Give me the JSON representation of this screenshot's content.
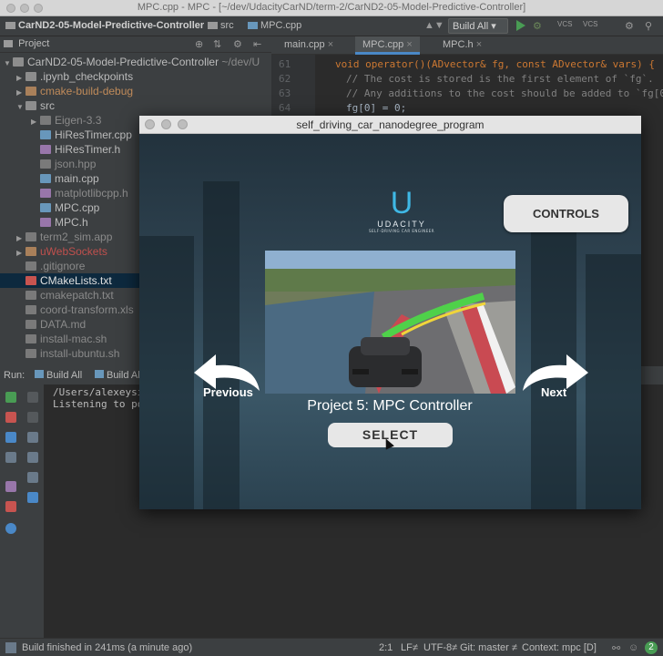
{
  "window": {
    "title": "MPC.cpp - MPC - [~/dev/UdacityCarND/term-2/CarND2-05-Model-Predictive-Controller]"
  },
  "navbar": {
    "project": "CarND2-05-Model-Predictive-Controller",
    "folder": "src",
    "file": "MPC.cpp",
    "build_config": "Build All",
    "vcs1": "VCS",
    "vcs2": "VCS"
  },
  "project_panel": {
    "title": "Project",
    "root": "CarND2-05-Model-Predictive-Controller",
    "root_path": "~/dev/U",
    "items": [
      {
        "label": ".ipynb_checkpoints"
      },
      {
        "label": "cmake-build-debug"
      },
      {
        "label": "src"
      },
      {
        "label": "Eigen-3.3"
      },
      {
        "label": "HiResTimer.cpp"
      },
      {
        "label": "HiResTimer.h"
      },
      {
        "label": "json.hpp"
      },
      {
        "label": "main.cpp"
      },
      {
        "label": "matplotlibcpp.h"
      },
      {
        "label": "MPC.cpp"
      },
      {
        "label": "MPC.h"
      },
      {
        "label": "term2_sim.app"
      },
      {
        "label": "uWebSockets"
      },
      {
        "label": ".gitignore"
      },
      {
        "label": "CMakeLists.txt"
      },
      {
        "label": "cmakepatch.txt"
      },
      {
        "label": "coord-transform.xls"
      },
      {
        "label": "DATA.md"
      },
      {
        "label": "install-mac.sh"
      },
      {
        "label": "install-ubuntu.sh"
      }
    ]
  },
  "editor": {
    "tabs": [
      {
        "label": "main.cpp"
      },
      {
        "label": "MPC.cpp"
      },
      {
        "label": "MPC.h"
      }
    ],
    "line_numbers": [
      "61",
      "62",
      "63",
      "64",
      "65"
    ],
    "lines": [
      "void operator()(ADvector& fg, const ADvector& vars) {",
      "  // The cost is stored is the first element of `fg`.",
      "  // Any additions to the cost should be added to `fg[0`",
      "  fg[0] = 0;",
      ""
    ]
  },
  "run_panel": {
    "label": "Run:",
    "tab1": "Build All",
    "tab2": "Build Al",
    "console": [
      "/Users/alexeysim",
      "Listening to por"
    ]
  },
  "simulator": {
    "window_title": "self_driving_car_nanodegree_program",
    "logo_letter": "U",
    "logo_text": "UDACITY",
    "logo_subtext": "SELF-DRIVING CAR ENGINEER",
    "controls_label": "CONTROLS",
    "previous_label": "Previous",
    "next_label": "Next",
    "project_title": "Project 5: MPC Controller",
    "select_label": "SELECT"
  },
  "statusbar": {
    "message": "Build finished in 241ms (a minute ago)",
    "position": "2:1",
    "line_sep": "LF≠",
    "encoding": "UTF-8≠",
    "git": "Git: master ≠",
    "context": "Context: mpc [D]",
    "notif_count": "2"
  },
  "colors": {
    "accent": "#4a88c7",
    "udacity_blue": "#3fb8e5",
    "run_green": "#499c54"
  }
}
